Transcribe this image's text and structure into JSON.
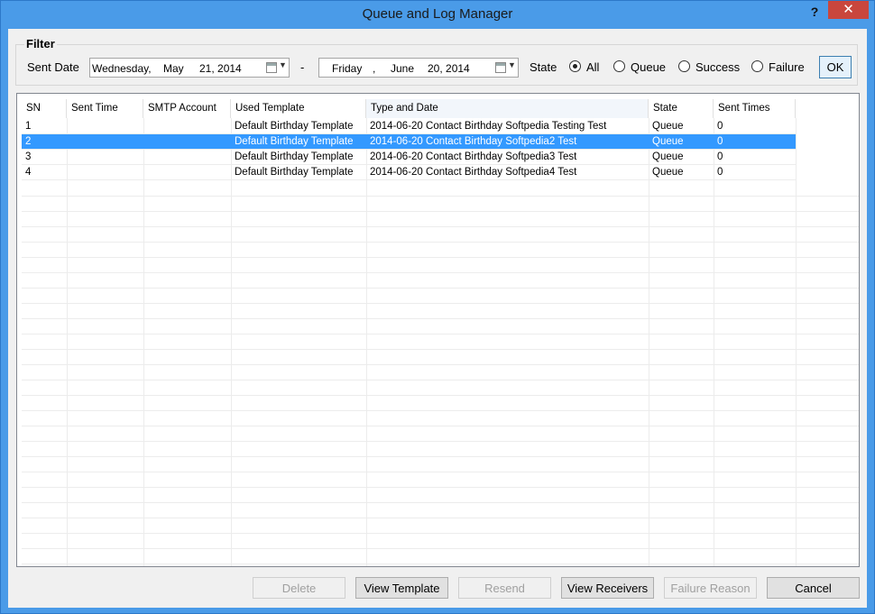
{
  "window": {
    "title": "Queue and Log Manager",
    "help": "?",
    "close": "✕"
  },
  "filter": {
    "legend": "Filter",
    "sent_date_label": "Sent Date",
    "date_from": {
      "weekday": "Wednesday,",
      "month": "May",
      "daysep": "21, 2014"
    },
    "date_sep": "-",
    "date_to": {
      "weekday": "Friday",
      "comma": ",",
      "month": "June",
      "daysep": "20, 2014"
    },
    "state_label": "State",
    "states": [
      "All",
      "Queue",
      "Success",
      "Failure"
    ],
    "selected_state": "All",
    "ok_label": "OK"
  },
  "table": {
    "columns": [
      "SN",
      "Sent Time",
      "SMTP Account",
      "Used Template",
      "Type and Date",
      "State",
      "Sent Times"
    ],
    "rows": [
      {
        "sn": "1",
        "sent_time": "",
        "smtp": "",
        "template": "Default Birthday Template",
        "type_date": "2014-06-20 Contact Birthday Softpedia Testing Test",
        "state": "Queue",
        "sent_times": "0"
      },
      {
        "sn": "2",
        "sent_time": "",
        "smtp": "",
        "template": "Default Birthday Template",
        "type_date": "2014-06-20 Contact Birthday Softpedia2  Test",
        "state": "Queue",
        "sent_times": "0"
      },
      {
        "sn": "3",
        "sent_time": "",
        "smtp": "",
        "template": "Default Birthday Template",
        "type_date": "2014-06-20 Contact Birthday Softpedia3  Test",
        "state": "Queue",
        "sent_times": "0"
      },
      {
        "sn": "4",
        "sent_time": "",
        "smtp": "",
        "template": "Default Birthday Template",
        "type_date": "2014-06-20 Contact Birthday Softpedia4  Test",
        "state": "Queue",
        "sent_times": "0"
      }
    ],
    "selected_row": 1
  },
  "buttons": {
    "delete": "Delete",
    "view_template": "View Template",
    "resend": "Resend",
    "view_receivers": "View Receivers",
    "failure_reason": "Failure Reason",
    "cancel": "Cancel"
  },
  "colors": {
    "selection": "#3399ff",
    "frame": "#4a9be8",
    "close": "#c9463d"
  }
}
